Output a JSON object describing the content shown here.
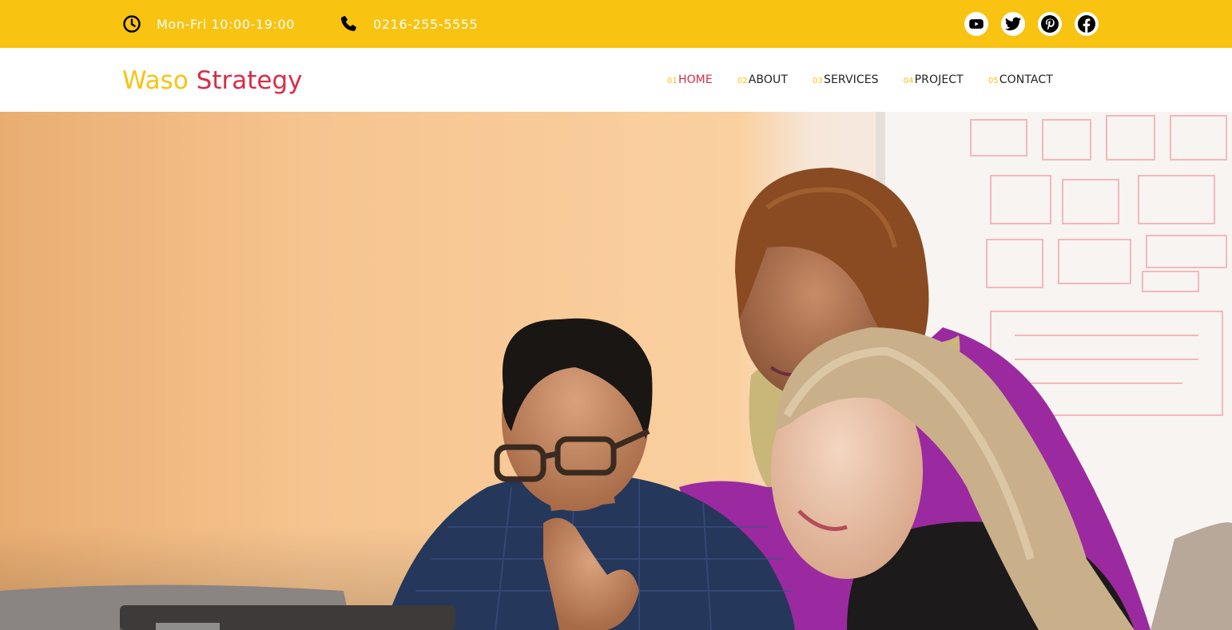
{
  "topbar": {
    "hours": {
      "icon": "clock-icon",
      "text": "Mon-Fri 10:00-19:00"
    },
    "phone": {
      "icon": "phone-icon",
      "text": "0216-255-5555"
    },
    "social": [
      {
        "name": "youtube-icon"
      },
      {
        "name": "twitter-icon"
      },
      {
        "name": "pinterest-icon"
      },
      {
        "name": "facebook-icon"
      }
    ]
  },
  "header": {
    "logo": {
      "part1": "Waso",
      "part2": "Strategy"
    },
    "menu": [
      {
        "num": "01",
        "label": "HOME",
        "active": true
      },
      {
        "num": "02",
        "label": "ABOUT"
      },
      {
        "num": "03",
        "label": "SERVICES"
      },
      {
        "num": "04",
        "label": "PROJECT"
      },
      {
        "num": "05",
        "label": "CONTACT"
      }
    ]
  },
  "hero": {
    "image": "team-meeting-photo"
  },
  "colors": {
    "accent": "#f8c311",
    "brand_red": "#d92c45",
    "text_dark": "#222222"
  }
}
